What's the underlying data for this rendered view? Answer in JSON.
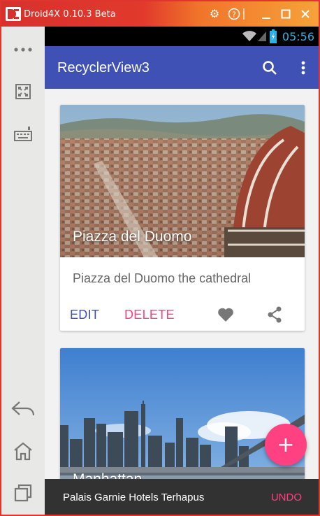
{
  "window": {
    "title": "Droid4X 0.10.3 Beta",
    "controls": [
      "gear-icon",
      "help-icon",
      "minimize-icon",
      "maximize-icon",
      "close-icon"
    ]
  },
  "sidebar": {
    "items": [
      "more-icon",
      "fullscreen-icon",
      "keyboard-icon",
      "back-icon",
      "home-icon",
      "recents-icon"
    ]
  },
  "statusbar": {
    "time": "05:56"
  },
  "appbar": {
    "title": "RecyclerView3",
    "actions": [
      "search-icon",
      "overflow-menu-icon"
    ],
    "color": "#3f51b5"
  },
  "cards": [
    {
      "title": "Piazza del Duomo",
      "description": "Piazza del Duomo the cathedral",
      "edit_label": "EDIT",
      "delete_label": "DELETE"
    },
    {
      "title": "Manhattan"
    }
  ],
  "fab": {
    "label": "+",
    "color": "#ff4081"
  },
  "snackbar": {
    "message": "Palais Garnie Hotels Terhapus",
    "action": "UNDO"
  }
}
